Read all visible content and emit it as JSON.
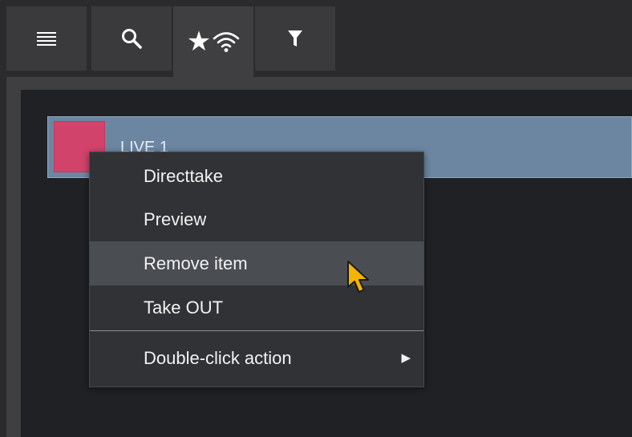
{
  "toolbar": {
    "tabs": [
      {
        "id": "list-view",
        "icon": "list-icon",
        "active": false
      },
      {
        "id": "search",
        "icon": "search-icon",
        "active": false
      },
      {
        "id": "favorites-live",
        "icon": "star-wifi-icon",
        "active": true
      },
      {
        "id": "filter",
        "icon": "filter-icon",
        "active": false
      }
    ]
  },
  "list": {
    "items": [
      {
        "label": "LIVE 1",
        "color": "#d1436a",
        "selected": true
      }
    ]
  },
  "context_menu": {
    "items": [
      {
        "label": "Directtake"
      },
      {
        "label": "Preview"
      },
      {
        "label": "Remove item",
        "highlighted": true
      },
      {
        "label": "Take OUT"
      },
      {
        "label": "Double-click action",
        "submenu": true
      }
    ],
    "submenu_arrow": "▶"
  },
  "colors": {
    "background": "#2a2a2c",
    "panel": "#1f2125",
    "selection": "#6c86a2",
    "swatch": "#d1436a",
    "menu_bg": "#303236",
    "menu_hover": "#4a4d52",
    "cursor": "#f5b400"
  }
}
